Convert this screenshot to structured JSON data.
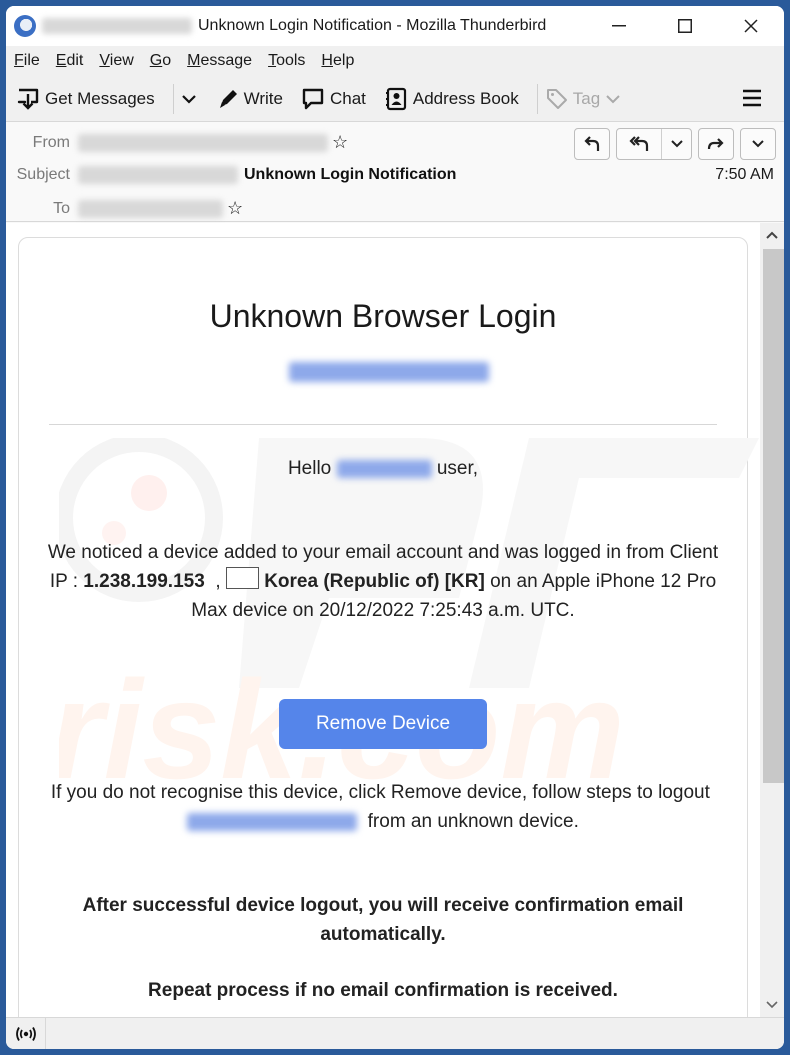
{
  "window": {
    "title": "Unknown Login Notification - Mozilla Thunderbird",
    "sender_redacted": true,
    "controls": {
      "minimize": "—",
      "maximize": "☐",
      "close": "✕"
    }
  },
  "menubar": {
    "items": [
      "File",
      "Edit",
      "View",
      "Go",
      "Message",
      "Tools",
      "Help"
    ]
  },
  "toolbar": {
    "get_messages": "Get Messages",
    "write": "Write",
    "chat": "Chat",
    "address_book": "Address Book",
    "tag": "Tag"
  },
  "header": {
    "from_label": "From",
    "subject_label": "Subject",
    "to_label": "To",
    "subject": "Unknown Login Notification",
    "time": "7:50 AM",
    "star": "☆"
  },
  "email": {
    "heading": "Unknown Browser Login",
    "hello_prefix": "Hello",
    "hello_suffix": "user,",
    "notice_part1": "We noticed a device added to your email account and was logged in from Client IP :",
    "ip": "1.238.199.153",
    "comma": ",",
    "country": "Korea (Republic of) [KR]",
    "notice_part2": "on an Apple iPhone 12 Pro Max device on 20/12/2022 7:25:43 a.m. UTC.",
    "button": "Remove Device",
    "ifnot_part1": "If you do not recognise this device, click Remove device, follow steps to logout",
    "ifnot_part2": "from an unknown device.",
    "after": "After successful device logout, you will receive confirmation email automatically.",
    "repeat": "Repeat process if no email confirmation is received."
  },
  "scrollbar": {
    "up": "^",
    "down": "v"
  },
  "colors": {
    "button_bg": "#5585ea",
    "window_frame": "#2a5a9a"
  }
}
